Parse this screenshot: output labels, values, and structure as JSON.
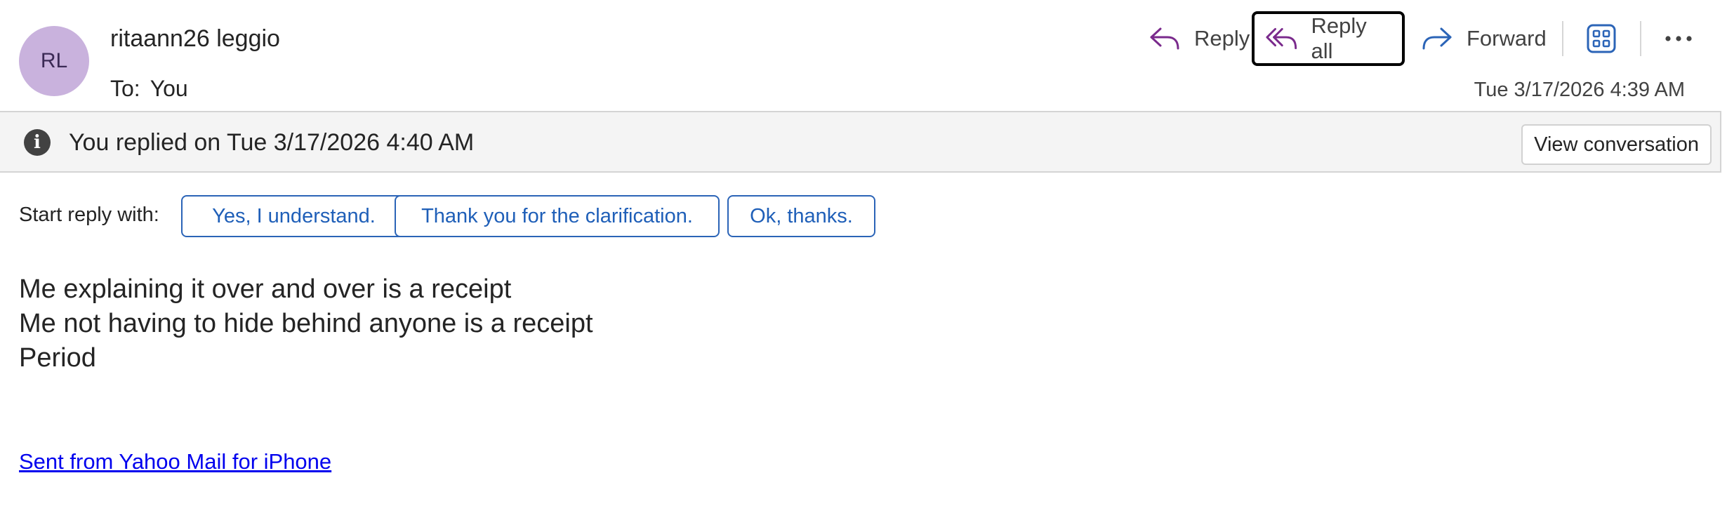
{
  "message": {
    "avatar_initials": "RL",
    "sender_name": "ritaann26 leggio",
    "to_label": "To:",
    "to_value": "You",
    "timestamp": "Tue 3/17/2026 4:39 AM"
  },
  "actions": {
    "reply_label": "Reply",
    "reply_all_label": "Reply all",
    "forward_label": "Forward",
    "apps_icon": "apps-grid-icon",
    "more_icon": "more-ellipsis-icon",
    "reply_icon_color": "#7a2a8c",
    "forward_icon_color": "#2b64b7"
  },
  "banner": {
    "icon": "info-icon",
    "text": "You replied on Tue 3/17/2026 4:40 AM",
    "button_label": "View conversation"
  },
  "quick_reply": {
    "label": "Start reply with:",
    "suggestions": [
      "Yes, I understand.",
      "Thank you for the clarification.",
      "Ok, thanks."
    ]
  },
  "body": {
    "lines": [
      "Me explaining it over and over is a receipt",
      "Me not having to hide behind anyone is a receipt",
      "Period"
    ],
    "signature_link": "Sent from Yahoo Mail for iPhone"
  },
  "colors": {
    "avatar_bg": "#c9b2dd",
    "link": "#0000ee",
    "chip_border": "#2b64b7",
    "banner_bg": "#f4f4f4"
  }
}
